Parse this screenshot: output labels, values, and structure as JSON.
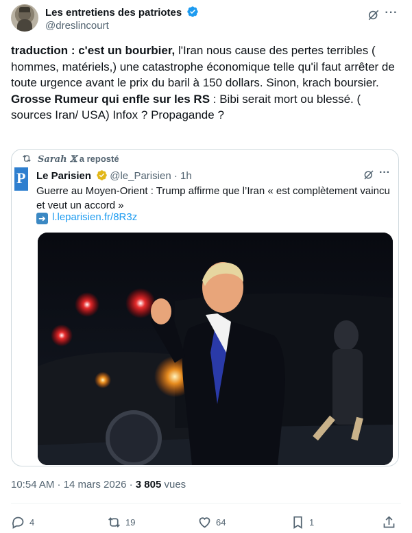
{
  "header": {
    "display_name": "Les entretiens des patriotes",
    "handle": "@dreslincourt",
    "avatar_icon": "portrait-avatar",
    "verified_color": "#1d9bf0"
  },
  "tweet": {
    "line1_bold": "traduction : c'est un bourbier,",
    "line1_rest": " l'Iran nous cause des pertes terribles ( hommes, matériels,)  une catastrophe économique telle qu'il faut arrêter de toute urgence avant le prix du baril à 150 dollars. Sinon, krach boursier.",
    "line2_bold": "Grosse Rumeur qui enfle sur les RS",
    "line2_rest": " : Bibi serait mort ou blessé. ( sources Iran/ USA) Infox ? Propagande ?"
  },
  "quote": {
    "repost_prefix": "Sarah 𝕏",
    "repost_suffix": " a reposté",
    "name": "Le Parisien",
    "handle": "@le_Parisien",
    "separator": " · ",
    "time": "1h",
    "text": "Guerre au Moyen-Orient : Trump affirme que l’Iran « est complètement vaincu et veut un accord »",
    "link": "l.leparisien.fr/8R3z",
    "logo_letter": "P",
    "logo_color": "#2f7fcf",
    "verified_color": "#e2b719"
  },
  "meta": {
    "time": "10:54 AM · 14 mars 2026 · ",
    "views_count": "3 805",
    "views_label": " vues"
  },
  "actions": {
    "replies": "4",
    "reposts": "19",
    "likes": "64",
    "bookmarks": "1"
  },
  "colors": {
    "text": "#0f1419",
    "muted": "#536471",
    "link": "#1d9bf0",
    "border": "#cfd9de"
  }
}
